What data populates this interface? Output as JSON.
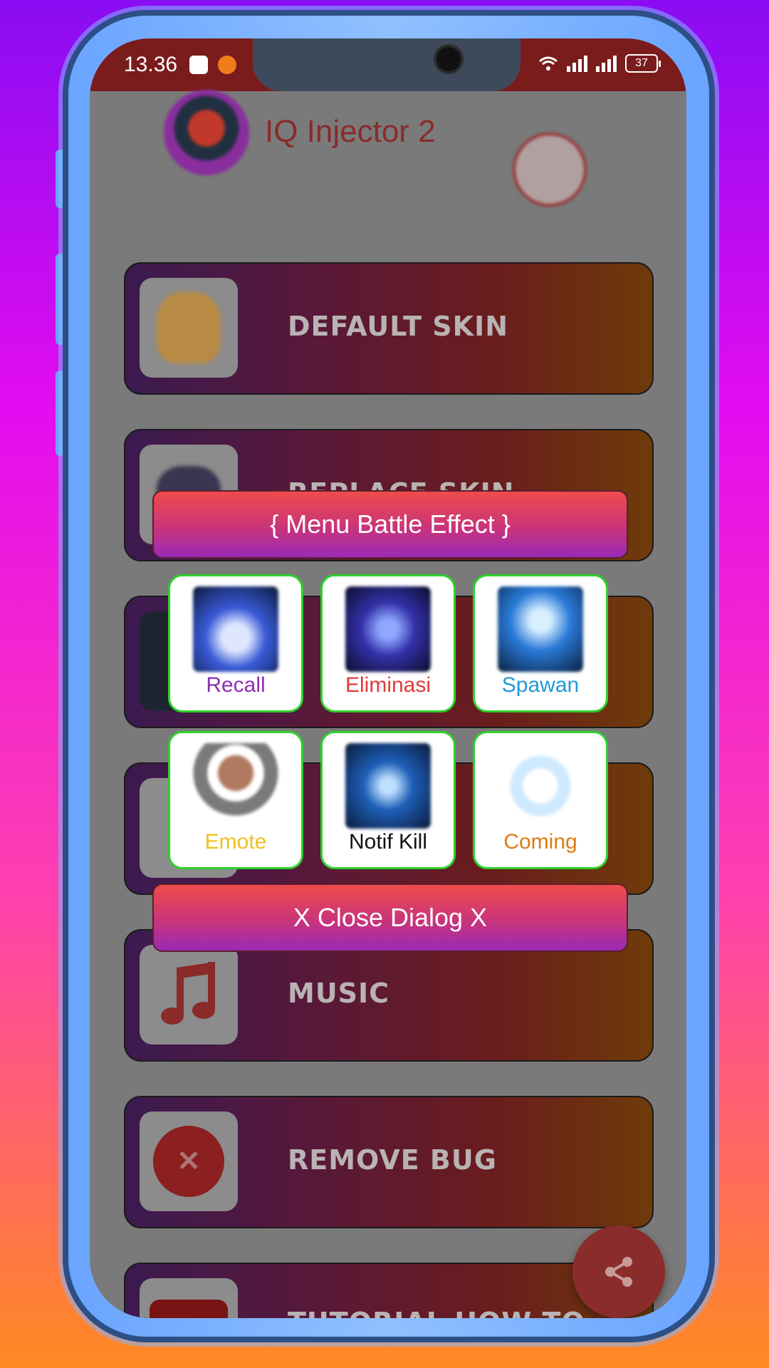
{
  "status_bar": {
    "time": "13.36",
    "battery": "37"
  },
  "app": {
    "title": "IQ Injector 2"
  },
  "menu_items": [
    {
      "label": "DEFAULT SKIN"
    },
    {
      "label": "REPLACE SKIN"
    },
    {
      "label": ""
    },
    {
      "label": ""
    },
    {
      "label": "MUSIC"
    },
    {
      "label": "REMOVE BUG"
    },
    {
      "label": "TUTORIAL HOW TO USE"
    }
  ],
  "dialog": {
    "title": "{ Menu Battle Effect }",
    "close_label": "X Close Dialog X",
    "tiles": [
      {
        "label": "Recall",
        "color": "#8e2fb5"
      },
      {
        "label": "Eliminasi",
        "color": "#e23a3a"
      },
      {
        "label": "Spawan",
        "color": "#1f9ad8"
      },
      {
        "label": "Emote",
        "color": "#f0c020"
      },
      {
        "label": "Notif Kill",
        "color": "#111111"
      },
      {
        "label": "Coming",
        "color": "#e07b12"
      }
    ]
  },
  "colors": {
    "accent": "#2bd22b",
    "statusbar": "#7a1c1c"
  }
}
